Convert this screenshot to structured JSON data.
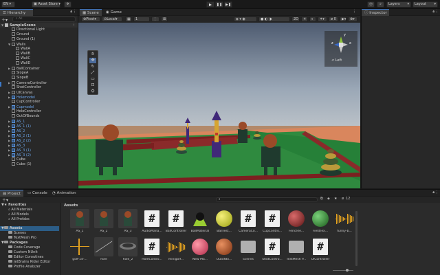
{
  "toolbar": {
    "account": "EN",
    "asset_store": "Asset Store",
    "layers": "Layers",
    "layout": "Layout"
  },
  "hierarchy": {
    "tab": "Hierarchy",
    "search_placeholder": "All",
    "scene": "SampleScene",
    "rows": [
      {
        "label": "Directional Light",
        "indent": 2,
        "blue": false,
        "expand": ""
      },
      {
        "label": "Ground",
        "indent": 2,
        "blue": false,
        "expand": ""
      },
      {
        "label": "Ground (1)",
        "indent": 2,
        "blue": false,
        "expand": ""
      },
      {
        "label": "Walls",
        "indent": 2,
        "blue": false,
        "expand": "▼"
      },
      {
        "label": "WallA",
        "indent": 3,
        "blue": false,
        "expand": ""
      },
      {
        "label": "WallB",
        "indent": 3,
        "blue": false,
        "expand": ""
      },
      {
        "label": "WallC",
        "indent": 3,
        "blue": false,
        "expand": ""
      },
      {
        "label": "WallD",
        "indent": 3,
        "blue": false,
        "expand": ""
      },
      {
        "label": "BallContainer",
        "indent": 2,
        "blue": false,
        "expand": "▶"
      },
      {
        "label": "SlopeA",
        "indent": 2,
        "blue": false,
        "expand": ""
      },
      {
        "label": "SlopeB",
        "indent": 2,
        "blue": false,
        "expand": ""
      },
      {
        "label": "CameraController",
        "indent": 2,
        "blue": false,
        "expand": "▶"
      },
      {
        "label": "ShotController",
        "indent": 2,
        "blue": false,
        "expand": ""
      },
      {
        "label": "UICanvas",
        "indent": 2,
        "blue": false,
        "expand": "▶"
      },
      {
        "label": "Holemodel",
        "indent": 2,
        "blue": true,
        "expand": "▶"
      },
      {
        "label": "CupController",
        "indent": 2,
        "blue": false,
        "expand": ""
      },
      {
        "label": "Cupmodel",
        "indent": 2,
        "blue": true,
        "expand": "▶"
      },
      {
        "label": "HoleController",
        "indent": 2,
        "blue": false,
        "expand": ""
      },
      {
        "label": "OutOfBounds",
        "indent": 2,
        "blue": false,
        "expand": ""
      },
      {
        "label": "AS_1",
        "indent": 2,
        "blue": true,
        "expand": "▶"
      },
      {
        "label": "AS_1 (1)",
        "indent": 2,
        "blue": true,
        "expand": "▶"
      },
      {
        "label": "AS_2",
        "indent": 2,
        "blue": true,
        "expand": "▶"
      },
      {
        "label": "AS_2 (1)",
        "indent": 2,
        "blue": true,
        "expand": "▶"
      },
      {
        "label": "AS_2 (2)",
        "indent": 2,
        "blue": true,
        "expand": "▶"
      },
      {
        "label": "AS_3",
        "indent": 2,
        "blue": true,
        "expand": "▶"
      },
      {
        "label": "AS_3 (1)",
        "indent": 2,
        "blue": true,
        "expand": "▶"
      },
      {
        "label": "AS_3 (2)",
        "indent": 2,
        "blue": true,
        "expand": "▶"
      },
      {
        "label": "Cube",
        "indent": 2,
        "blue": false,
        "expand": ""
      },
      {
        "label": "Cube (1)",
        "indent": 2,
        "blue": false,
        "expand": ""
      }
    ]
  },
  "scene_view": {
    "tab_scene": "Scene",
    "tab_game": "Game",
    "pivot": "Pivot",
    "local": "Local",
    "grid_value": "1",
    "gizmo_view_label": "< Left",
    "gizmo_axes": {
      "x": "x",
      "y": "y",
      "z": "z"
    }
  },
  "inspector": {
    "tab": "Inspector"
  },
  "project": {
    "tab_project": "Project",
    "tab_console": "Console",
    "tab_animation": "Animation",
    "favorites": "Favorites",
    "favorite_items": [
      "All Materials",
      "All Models",
      "All Prefabs"
    ],
    "assets_root": "Assets",
    "asset_folders": [
      "Scenes",
      "TextMesh Pro"
    ],
    "packages_root": "Packages",
    "package_items": [
      "Code Coverage",
      "Custom NUnit",
      "Editor Coroutines",
      "JetBrains Rider Editor",
      "Profile Analyzer"
    ],
    "breadcrumb": "Assets",
    "hidden_count": "12",
    "assets_row1": [
      {
        "label": "AS_1",
        "kind": "model"
      },
      {
        "label": "AS_2",
        "kind": "model"
      },
      {
        "label": "AS_3",
        "kind": "model"
      },
      {
        "label": "AudioMana...",
        "kind": "script"
      },
      {
        "label": "BallController",
        "kind": "script"
      },
      {
        "label": "BallMaterial",
        "kind": "material-green-yellow"
      },
      {
        "label": "BallTest...",
        "kind": "sphere-yellow"
      },
      {
        "label": "CameraCo...",
        "kind": "script"
      },
      {
        "label": "CupContro...",
        "kind": "script"
      },
      {
        "label": "FenceTe...",
        "kind": "sphere-red"
      },
      {
        "label": "FieldTex...",
        "kind": "sphere-green"
      },
      {
        "label": "funny-b...",
        "kind": "audio"
      }
    ],
    "assets_row2": [
      {
        "label": "golf-14-...",
        "kind": "audio-spike"
      },
      {
        "label": "hole",
        "kind": "line"
      },
      {
        "label": "hole_2",
        "kind": "cup"
      },
      {
        "label": "HoleContro...",
        "kind": "script"
      },
      {
        "label": "minigolf...",
        "kind": "audio"
      },
      {
        "label": "New Ma...",
        "kind": "sphere-pink"
      },
      {
        "label": "OutofBo...",
        "kind": "sphere-orange"
      },
      {
        "label": "Scenes",
        "kind": "folder"
      },
      {
        "label": "ShotContro...",
        "kind": "script"
      },
      {
        "label": "TextMesh P...",
        "kind": "folder"
      },
      {
        "label": "UIController",
        "kind": "script"
      }
    ]
  },
  "colors": {
    "accent": "#3d7acb",
    "sky_top": "#7e8aa0",
    "field_green": "#3a8a3e",
    "wall_red": "#8a2a2a",
    "border_orange": "#d8845a"
  }
}
